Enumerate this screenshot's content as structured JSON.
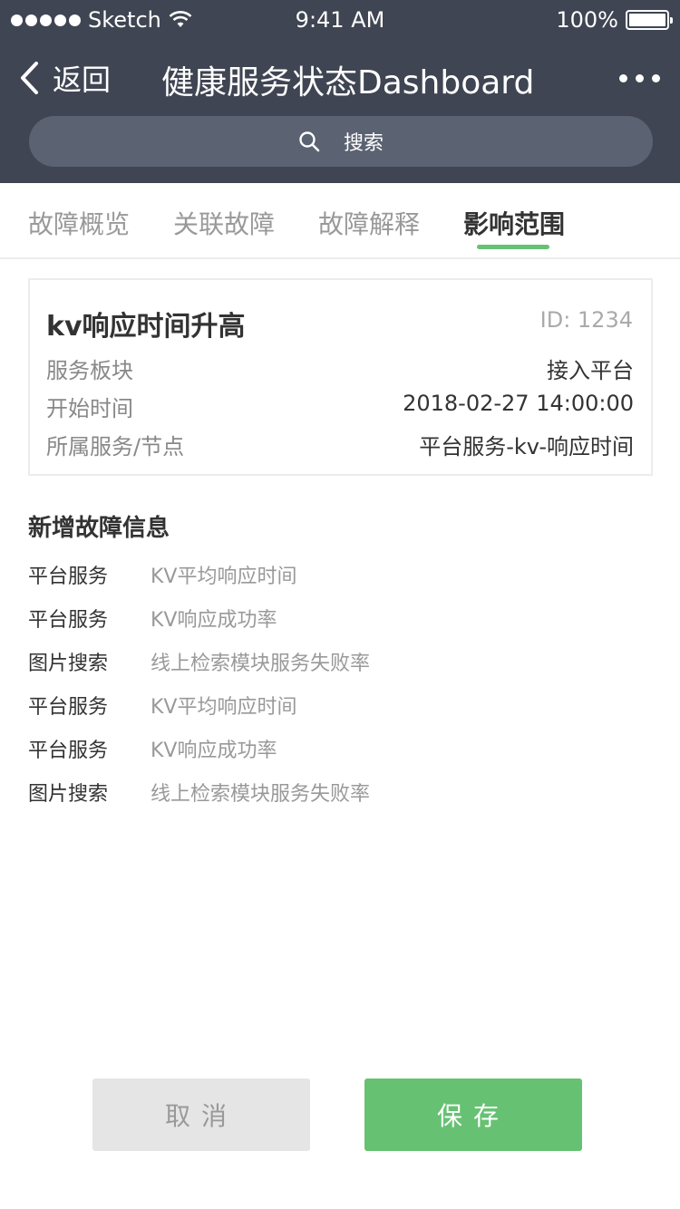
{
  "status_bar": {
    "carrier": "Sketch",
    "time": "9:41 AM",
    "battery": "100%"
  },
  "nav": {
    "back_label": "返回",
    "title": "健康服务状态Dashboard"
  },
  "search": {
    "placeholder": "搜索"
  },
  "tabs": [
    {
      "label": "故障概览"
    },
    {
      "label": "关联故障"
    },
    {
      "label": "故障解释"
    },
    {
      "label": "影响范围",
      "active": true
    }
  ],
  "card": {
    "title": "kv响应时间升高",
    "id": "ID: 1234",
    "rows": [
      {
        "label": "服务板块",
        "value": "接入平台"
      },
      {
        "label": "开始时间",
        "value": "2018-02-27 14:00:00"
      },
      {
        "label": "所属服务/节点",
        "value": "平台服务-kv-响应时间"
      }
    ]
  },
  "section": {
    "title": "新增故障信息",
    "items": [
      {
        "category": "平台服务",
        "metric": "KV平均响应时间"
      },
      {
        "category": "平台服务",
        "metric": "KV响应成功率"
      },
      {
        "category": "图片搜索",
        "metric": "线上检索模块服务失败率"
      },
      {
        "category": "平台服务",
        "metric": "KV平均响应时间"
      },
      {
        "category": "平台服务",
        "metric": "KV响应成功率"
      },
      {
        "category": "图片搜索",
        "metric": "线上检索模块服务失败率"
      }
    ]
  },
  "buttons": {
    "cancel": "取消",
    "save": "保存"
  },
  "colors": {
    "header_bg": "#3f4552",
    "accent_green": "#67c173",
    "cancel_bg": "#e5e5e5"
  }
}
